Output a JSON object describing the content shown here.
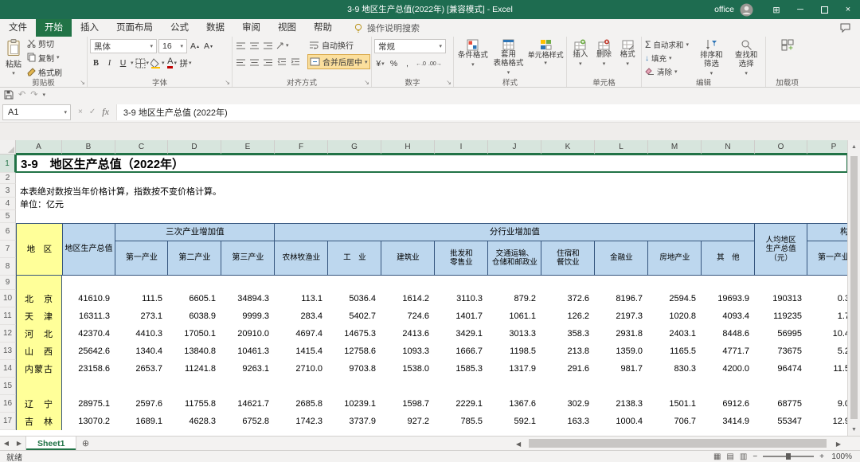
{
  "title_bar": {
    "title": "3-9 地区生产总值(2022年)  [兼容模式] - Excel",
    "account": "office"
  },
  "ribbon_tabs": {
    "items": [
      "文件",
      "开始",
      "插入",
      "页面布局",
      "公式",
      "数据",
      "审阅",
      "视图",
      "帮助"
    ],
    "active_index": 1,
    "search_label": "操作说明搜索"
  },
  "ribbon": {
    "clipboard": {
      "label": "剪贴板",
      "paste": "粘贴",
      "cut": "剪切",
      "copy": "复制",
      "format_painter": "格式刷"
    },
    "font": {
      "label": "字体",
      "name": "黑体",
      "size": "16",
      "bold": "B",
      "italic": "I",
      "underline": "U",
      "phonetic": "拼"
    },
    "alignment": {
      "label": "对齐方式",
      "wrap": "自动换行",
      "merge": "合并后居中"
    },
    "number": {
      "label": "数字",
      "format": "常规",
      "currency": "¥",
      "percent": "%",
      "comma": ",",
      "decimal_inc": "←.0",
      "decimal_dec": ".00→"
    },
    "styles": {
      "label": "样式",
      "conditional": "条件格式",
      "table": "套用\n表格格式",
      "cell": "单元格样式"
    },
    "cells": {
      "label": "单元格",
      "insert": "插入",
      "delete": "删除",
      "format": "格式"
    },
    "editing": {
      "label": "编辑",
      "sigma": "Σ",
      "autosum": "自动求和",
      "fill": "填充",
      "clear": "清除",
      "sort": "排序和\n筛选",
      "find": "查找和\n选择"
    },
    "addins": {
      "label": "加载项"
    }
  },
  "formula_bar": {
    "name_box": "A1",
    "fx": "fx",
    "value": "3-9 地区生产总值 (2022年)"
  },
  "grid": {
    "columns": [
      "A",
      "B",
      "C",
      "D",
      "E",
      "F",
      "G",
      "H",
      "I",
      "J",
      "K",
      "L",
      "M",
      "N",
      "O",
      "P"
    ],
    "rows": [
      "1",
      "2",
      "3",
      "4",
      "5",
      "6",
      "7",
      "8",
      "9",
      "10",
      "11",
      "12",
      "13",
      "14",
      "15",
      "16",
      "17"
    ]
  },
  "sheet": {
    "title": "3-9　地区生产总值（2022年）",
    "note": "本表绝对数按当年价格计算，指数按不变价格计算。",
    "unit": "单位：亿元",
    "header": {
      "region": "地　区",
      "gdp": "地区生产总值",
      "three_industries_group": "三次产业增加值",
      "three_industries": [
        "第一产业",
        "第二产业",
        "第三产业"
      ],
      "by_industry_group": "分行业增加值",
      "by_industry": [
        "农林牧渔业",
        "工　业",
        "建筑业",
        "批发和\n零售业",
        "交通运输、\n仓储和邮政业",
        "住宿和\n餐饮业",
        "金融业",
        "房地产业",
        "其　他"
      ],
      "per_capita": "人均地区\n生产总值\n（元）",
      "composition_group": "构成",
      "composition_first": "第一产业"
    },
    "data_rows": [
      {
        "region": "北　京",
        "values": [
          "41610.9",
          "111.5",
          "6605.1",
          "34894.3",
          "113.1",
          "5036.4",
          "1614.2",
          "3110.3",
          "879.2",
          "372.6",
          "8196.7",
          "2594.5",
          "19693.9",
          "190313"
        ],
        "p": "0.3"
      },
      {
        "region": "天　津",
        "values": [
          "16311.3",
          "273.1",
          "6038.9",
          "9999.3",
          "283.4",
          "5402.7",
          "724.6",
          "1401.7",
          "1061.1",
          "126.2",
          "2197.3",
          "1020.8",
          "4093.4",
          "119235"
        ],
        "p": "1.7"
      },
      {
        "region": "河　北",
        "values": [
          "42370.4",
          "4410.3",
          "17050.1",
          "20910.0",
          "4697.4",
          "14675.3",
          "2413.6",
          "3429.1",
          "3013.3",
          "358.3",
          "2931.8",
          "2403.1",
          "8448.6",
          "56995"
        ],
        "p": "10.4"
      },
      {
        "region": "山　西",
        "values": [
          "25642.6",
          "1340.4",
          "13840.8",
          "10461.3",
          "1415.4",
          "12758.6",
          "1093.3",
          "1666.7",
          "1198.5",
          "213.8",
          "1359.0",
          "1165.5",
          "4771.7",
          "73675"
        ],
        "p": "5.2"
      },
      {
        "region": "内蒙古",
        "values": [
          "23158.6",
          "2653.7",
          "11241.8",
          "9263.1",
          "2710.0",
          "9703.8",
          "1538.0",
          "1585.3",
          "1317.9",
          "291.6",
          "981.7",
          "830.3",
          "4200.0",
          "96474"
        ],
        "p": "11.5"
      },
      {
        "region": "辽　宁",
        "values": [
          "28975.1",
          "2597.6",
          "11755.8",
          "14621.7",
          "2685.8",
          "10239.1",
          "1598.7",
          "2229.1",
          "1367.6",
          "302.9",
          "2138.3",
          "1501.1",
          "6912.6",
          "68775"
        ],
        "p": "9.0"
      },
      {
        "region": "吉　林",
        "values": [
          "13070.2",
          "1689.1",
          "4628.3",
          "6752.8",
          "1742.3",
          "3737.9",
          "927.2",
          "785.5",
          "592.1",
          "163.3",
          "1000.4",
          "706.7",
          "3414.9",
          "55347"
        ],
        "p": "12.9"
      }
    ]
  },
  "sheet_tabs": {
    "active": "Sheet1"
  },
  "status_bar": {
    "ready": "就绪",
    "zoom": "100%"
  }
}
